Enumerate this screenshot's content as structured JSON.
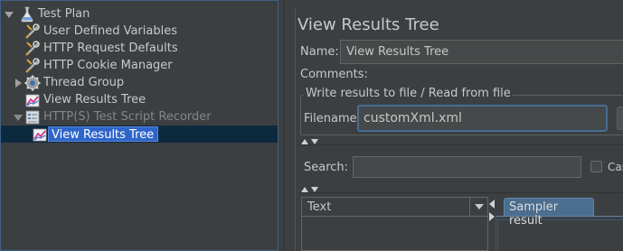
{
  "tree": {
    "items": [
      {
        "label": "Test Plan",
        "icon": "flask-icon"
      },
      {
        "label": "User Defined Variables",
        "icon": "wrench-icon"
      },
      {
        "label": "HTTP Request Defaults",
        "icon": "wrench-icon"
      },
      {
        "label": "HTTP Cookie Manager",
        "icon": "wrench-icon"
      },
      {
        "label": "Thread Group",
        "icon": "gear-icon"
      },
      {
        "label": "View Results Tree",
        "icon": "chart-icon"
      },
      {
        "label": "HTTP(S) Test Script Recorder",
        "icon": "recorder-icon"
      },
      {
        "label": "View Results Tree",
        "icon": "chart-icon"
      }
    ]
  },
  "panel": {
    "title": "View Results Tree",
    "name_label": "Name:",
    "name_value": "View Results Tree",
    "comments_label": "Comments:",
    "file_section_label": "Write results to file / Read from file",
    "filename_label": "Filename",
    "filename_value": "customXml.xml",
    "search_label": "Search:",
    "case_label": "Cas",
    "renderer_value": "Text",
    "tab_label": "Sampler result"
  },
  "colors": {
    "background": "#3c3f41",
    "selection": "#2f65ca",
    "focus_border": "#466d94"
  }
}
